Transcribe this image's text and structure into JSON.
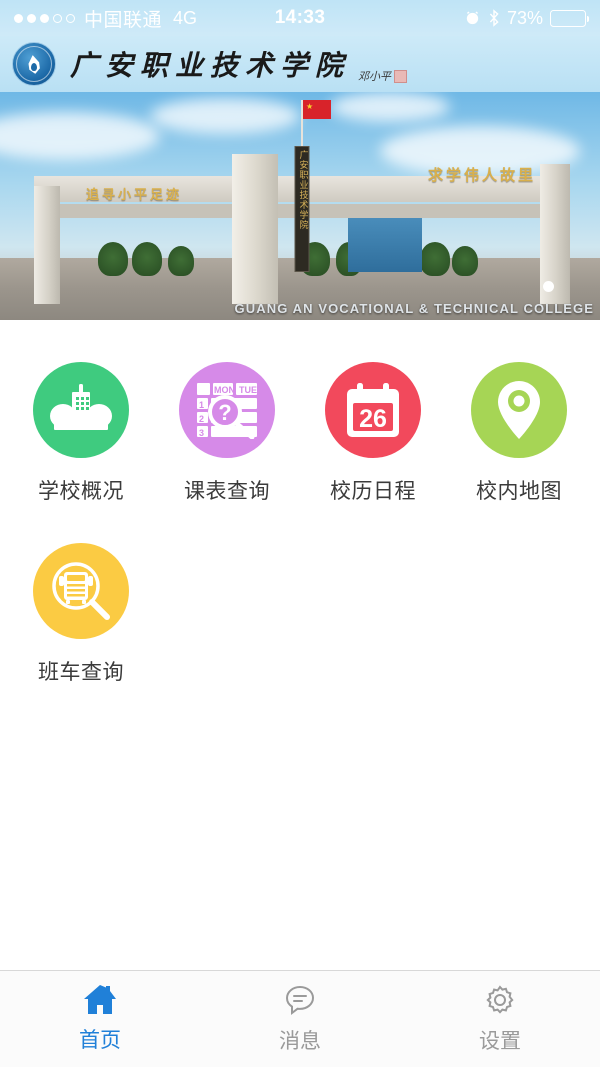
{
  "status_bar": {
    "signal_dots_filled": 3,
    "signal_dots_total": 5,
    "carrier": "中国联通",
    "network": "4G",
    "time": "14:33",
    "alarm_icon": "alarm-clock-icon",
    "bluetooth_icon": "bluetooth-icon",
    "battery_percent": "73%",
    "battery_level": 73
  },
  "header": {
    "logo_icon": "school-emblem-logo",
    "title": "广安职业技术学院",
    "signature": "邓小平",
    "seal_icon": "red-seal-stamp"
  },
  "banner": {
    "caption": "GUANG AN VOCATIONAL & TECHNICAL COLLEGE",
    "gate_plaque_text": "广安职业技术学院",
    "gate_left_text": "追寻小平足迹",
    "gate_right_text": "求学伟人故里",
    "dots_total": 1,
    "active_dot": 0
  },
  "grid": {
    "items": [
      {
        "label": "学校概况",
        "icon": "school-building-icon",
        "color": "#3FCB7F"
      },
      {
        "label": "课表查询",
        "icon": "timetable-search-icon",
        "color": "#D68AE8"
      },
      {
        "label": "校历日程",
        "icon": "calendar-icon",
        "color": "#F2495C",
        "calendar_day": "26"
      },
      {
        "label": "校内地图",
        "icon": "map-pin-icon",
        "color": "#A6D555"
      },
      {
        "label": "班车查询",
        "icon": "bus-search-icon",
        "color": "#FBCB43"
      }
    ],
    "timetable_labels": {
      "col1": "MON",
      "col2": "TUE",
      "rows": [
        "1",
        "2",
        "3"
      ],
      "mark": "?"
    }
  },
  "tabbar": {
    "active_color": "#2080D8",
    "inactive_color": "#9A9A9A",
    "tabs": [
      {
        "label": "首页",
        "icon": "home-icon",
        "active": true
      },
      {
        "label": "消息",
        "icon": "message-bubble-icon",
        "active": false
      },
      {
        "label": "设置",
        "icon": "gear-icon",
        "active": false
      }
    ]
  }
}
